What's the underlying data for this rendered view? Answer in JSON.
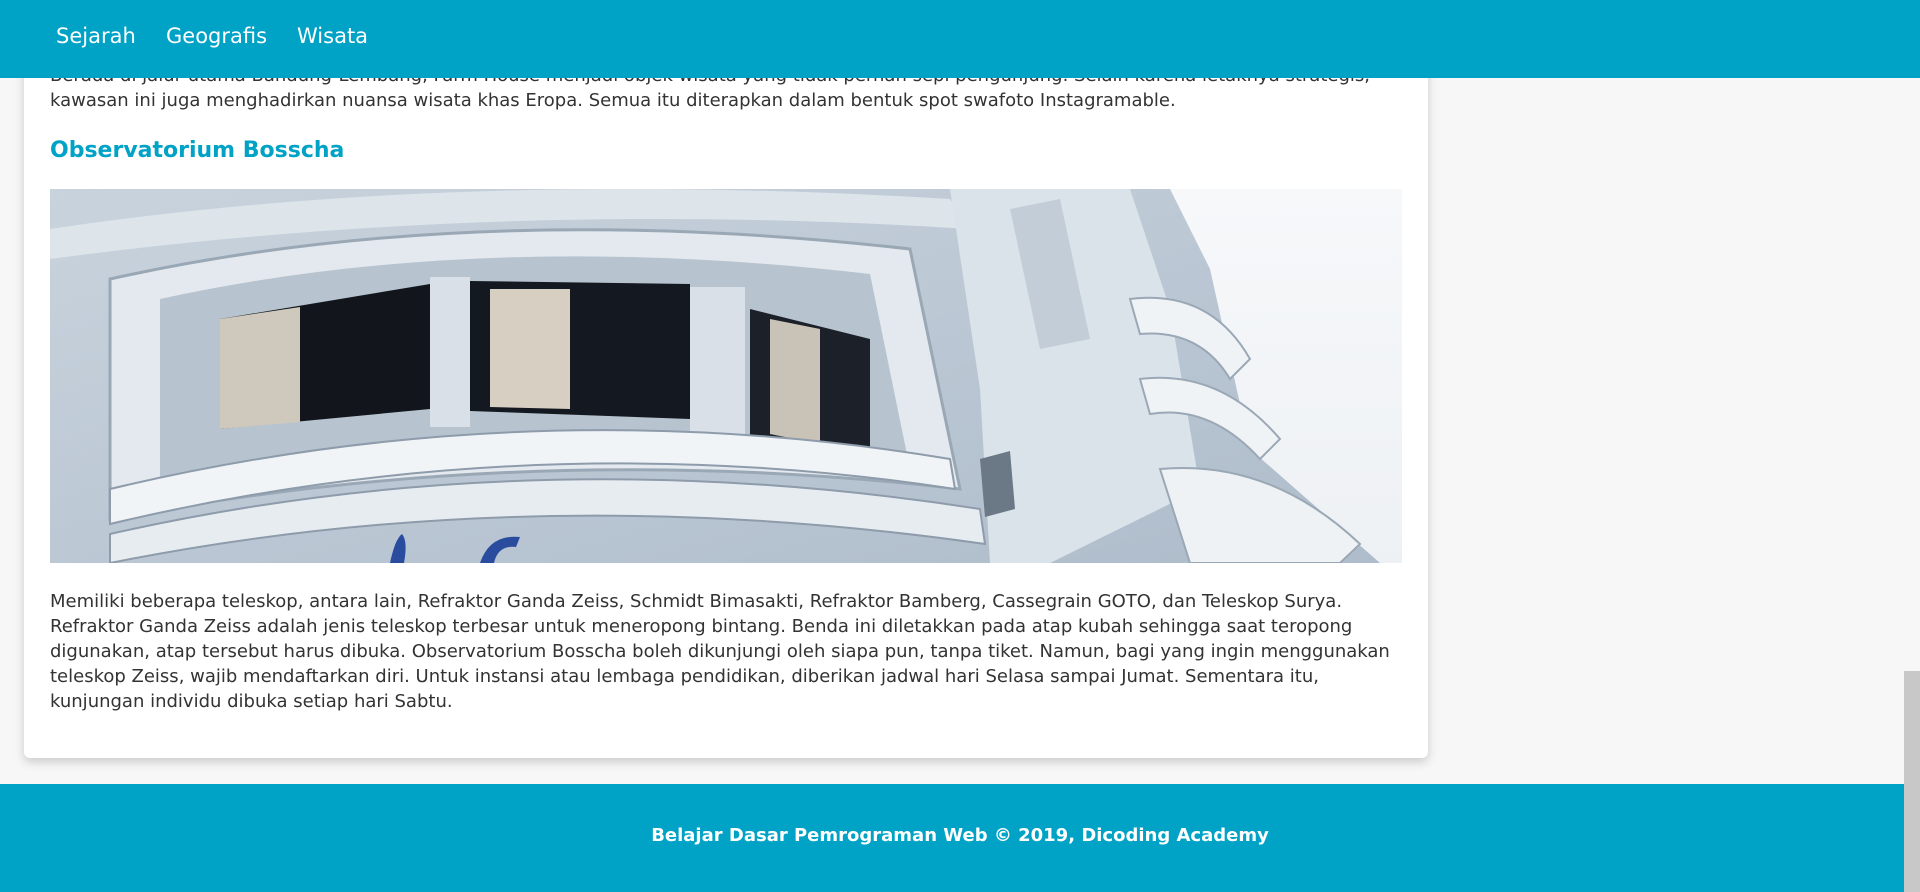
{
  "nav": {
    "items": [
      {
        "label": "Sejarah"
      },
      {
        "label": "Geografis"
      },
      {
        "label": "Wisata"
      }
    ]
  },
  "content": {
    "intro": "Berada di jalur utama Bandung-Lembang, Farm House menjadi objek wisata yang tidak pernah sepi pengunjung. Selain karena letaknya strategis, kawasan ini juga menghadirkan nuansa wisata khas Eropa. Semua itu diterapkan dalam bentuk spot swafoto Instagramable.",
    "section_title": "Observatorium Bosscha",
    "description": "Memiliki beberapa teleskop, antara lain, Refraktor Ganda Zeiss, Schmidt Bimasakti, Refraktor Bamberg, Cassegrain GOTO, dan Teleskop Surya. Refraktor Ganda Zeiss adalah jenis teleskop terbesar untuk meneropong bintang. Benda ini diletakkan pada atap kubah sehingga saat teropong digunakan, atap tersebut harus dibuka. Observatorium Bosscha boleh dikunjungi oleh siapa pun, tanpa tiket. Namun, bagi yang ingin menggunakan teleskop Zeiss, wajib mendaftarkan diri. Untuk instansi atau lembaga pendidikan, diberikan jadwal hari Selasa sampai Jumat. Sementara itu, kunjungan individu dibuka setiap hari Sabtu."
  },
  "footer": {
    "text": "Belajar Dasar Pemrograman Web © 2019, Dicoding Academy"
  },
  "colors": {
    "accent": "#00a2c6",
    "text": "#333333",
    "background": "#f7f7f7"
  }
}
